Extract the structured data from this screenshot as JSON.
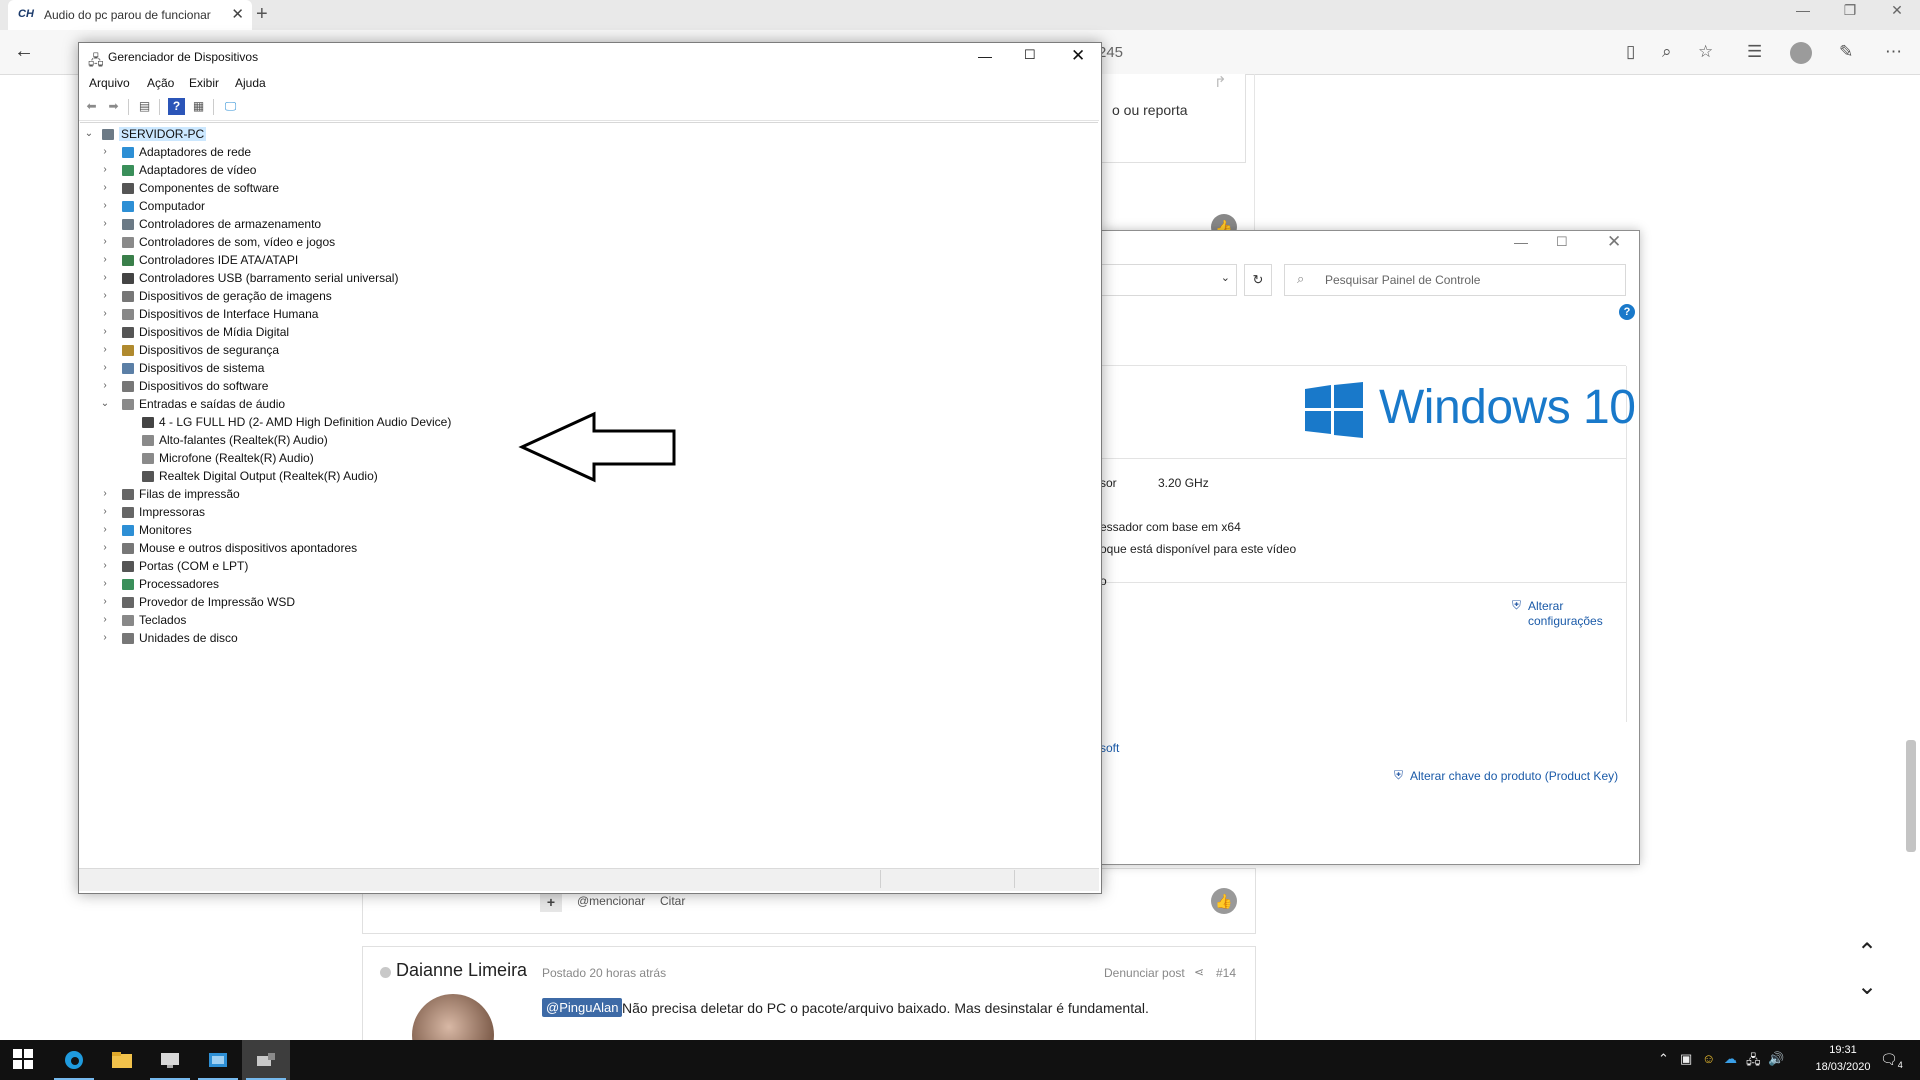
{
  "browser": {
    "tab_title": "Audio do pc parou de funcionar",
    "tab_favicon": "CH",
    "new_tab": "+",
    "close_tab": "✕",
    "url_fragment": "245",
    "window_buttons": [
      "—",
      "❐",
      "✕"
    ]
  },
  "forum": {
    "top_post_text": "o ou reporta",
    "mention_plus": "+",
    "mention_link": "@mencionar",
    "quote_link": "Citar",
    "post14": {
      "author": "Daianne Limeira",
      "posted": "Postado 20 horas atrás",
      "report": "Denunciar post",
      "share_icon": "share-icon",
      "number": "#14",
      "mention_tag": "@PinguAlan",
      "text": "Não precisa deletar do PC o pacote/arquivo baixado. Mas desinstalar é fundamental."
    }
  },
  "control_panel": {
    "search_placeholder": "Pesquisar Painel de Controle",
    "help": "?",
    "windows_brand": "Windows 10",
    "processor_label_fragment": "sor",
    "processor_speed": "3.20 GHz",
    "system_type_fragment": "essador com base em x64",
    "pen_touch_fragment": "oque está disponível para este vídeo",
    "fragment_o": "o",
    "change_settings_line1": "Alterar",
    "change_settings_line2": "configurações",
    "ms_fragment": "soft",
    "change_key": "Alterar chave do produto (Product Key)",
    "brand_color": "#1979ca"
  },
  "device_manager": {
    "title": "Gerenciador de Dispositivos",
    "menu": [
      "Arquivo",
      "Ação",
      "Exibir",
      "Ajuda"
    ],
    "root": "SERVIDOR-PC",
    "items": [
      {
        "label": "Adaptadores de rede",
        "expanded": false,
        "icon": "network-icon",
        "color": "#2d8fd5"
      },
      {
        "label": "Adaptadores de vídeo",
        "expanded": false,
        "icon": "display-adapter-icon",
        "color": "#3a8f5a"
      },
      {
        "label": "Componentes de software",
        "expanded": false,
        "icon": "software-component-icon",
        "color": "#555555"
      },
      {
        "label": "Computador",
        "expanded": false,
        "icon": "computer-icon",
        "color": "#2d8fd5"
      },
      {
        "label": "Controladores de armazenamento",
        "expanded": false,
        "icon": "storage-controller-icon",
        "color": "#6b7a86"
      },
      {
        "label": "Controladores de som, vídeo e jogos",
        "expanded": false,
        "icon": "sound-icon",
        "color": "#8a8a8a"
      },
      {
        "label": "Controladores IDE ATA/ATAPI",
        "expanded": false,
        "icon": "ide-icon",
        "color": "#3a7f4a"
      },
      {
        "label": "Controladores USB (barramento serial universal)",
        "expanded": false,
        "icon": "usb-icon",
        "color": "#444444"
      },
      {
        "label": "Dispositivos de geração de imagens",
        "expanded": false,
        "icon": "camera-icon",
        "color": "#777777"
      },
      {
        "label": "Dispositivos de Interface Humana",
        "expanded": false,
        "icon": "hid-icon",
        "color": "#888888"
      },
      {
        "label": "Dispositivos de Mídia Digital",
        "expanded": false,
        "icon": "media-device-icon",
        "color": "#555555"
      },
      {
        "label": "Dispositivos de segurança",
        "expanded": false,
        "icon": "security-device-icon",
        "color": "#b08a2e"
      },
      {
        "label": "Dispositivos de sistema",
        "expanded": false,
        "icon": "system-device-icon",
        "color": "#5b7fa6"
      },
      {
        "label": "Dispositivos do software",
        "expanded": false,
        "icon": "software-device-icon",
        "color": "#777777"
      },
      {
        "label": "Entradas e saídas de áudio",
        "expanded": true,
        "icon": "audio-io-icon",
        "color": "#8a8a8a"
      },
      {
        "label": "4 - LG FULL HD (2- AMD High Definition Audio Device)",
        "child": true,
        "icon": "monitor-audio-icon",
        "color": "#444444"
      },
      {
        "label": "Alto-falantes (Realtek(R) Audio)",
        "child": true,
        "icon": "speaker-icon",
        "color": "#8a8a8a"
      },
      {
        "label": "Microfone (Realtek(R) Audio)",
        "child": true,
        "icon": "microphone-icon",
        "color": "#8a8a8a"
      },
      {
        "label": "Realtek Digital Output (Realtek(R) Audio)",
        "child": true,
        "icon": "digital-output-icon",
        "color": "#555555"
      },
      {
        "label": "Filas de impressão",
        "expanded": false,
        "icon": "print-queue-icon",
        "color": "#666666"
      },
      {
        "label": "Impressoras",
        "expanded": false,
        "icon": "printer-icon",
        "color": "#666666"
      },
      {
        "label": "Monitores",
        "expanded": false,
        "icon": "monitor-icon",
        "color": "#2d8fd5"
      },
      {
        "label": "Mouse e outros dispositivos apontadores",
        "expanded": false,
        "icon": "mouse-icon",
        "color": "#777777"
      },
      {
        "label": "Portas (COM e LPT)",
        "expanded": false,
        "icon": "port-icon",
        "color": "#555555"
      },
      {
        "label": "Processadores",
        "expanded": false,
        "icon": "processor-icon",
        "color": "#3a8f5a"
      },
      {
        "label": "Provedor de Impressão WSD",
        "expanded": false,
        "icon": "wsd-icon",
        "color": "#666666"
      },
      {
        "label": "Teclados",
        "expanded": false,
        "icon": "keyboard-icon",
        "color": "#888888"
      },
      {
        "label": "Unidades de disco",
        "expanded": false,
        "icon": "disk-drive-icon",
        "color": "#777777"
      }
    ]
  },
  "taskbar": {
    "time": "19:31",
    "date": "18/03/2020",
    "notification_count": "4",
    "apps": [
      "edge-icon",
      "file-explorer-icon",
      "device-manager-app-icon",
      "control-panel-app-icon",
      "device-manager-active-icon"
    ]
  }
}
